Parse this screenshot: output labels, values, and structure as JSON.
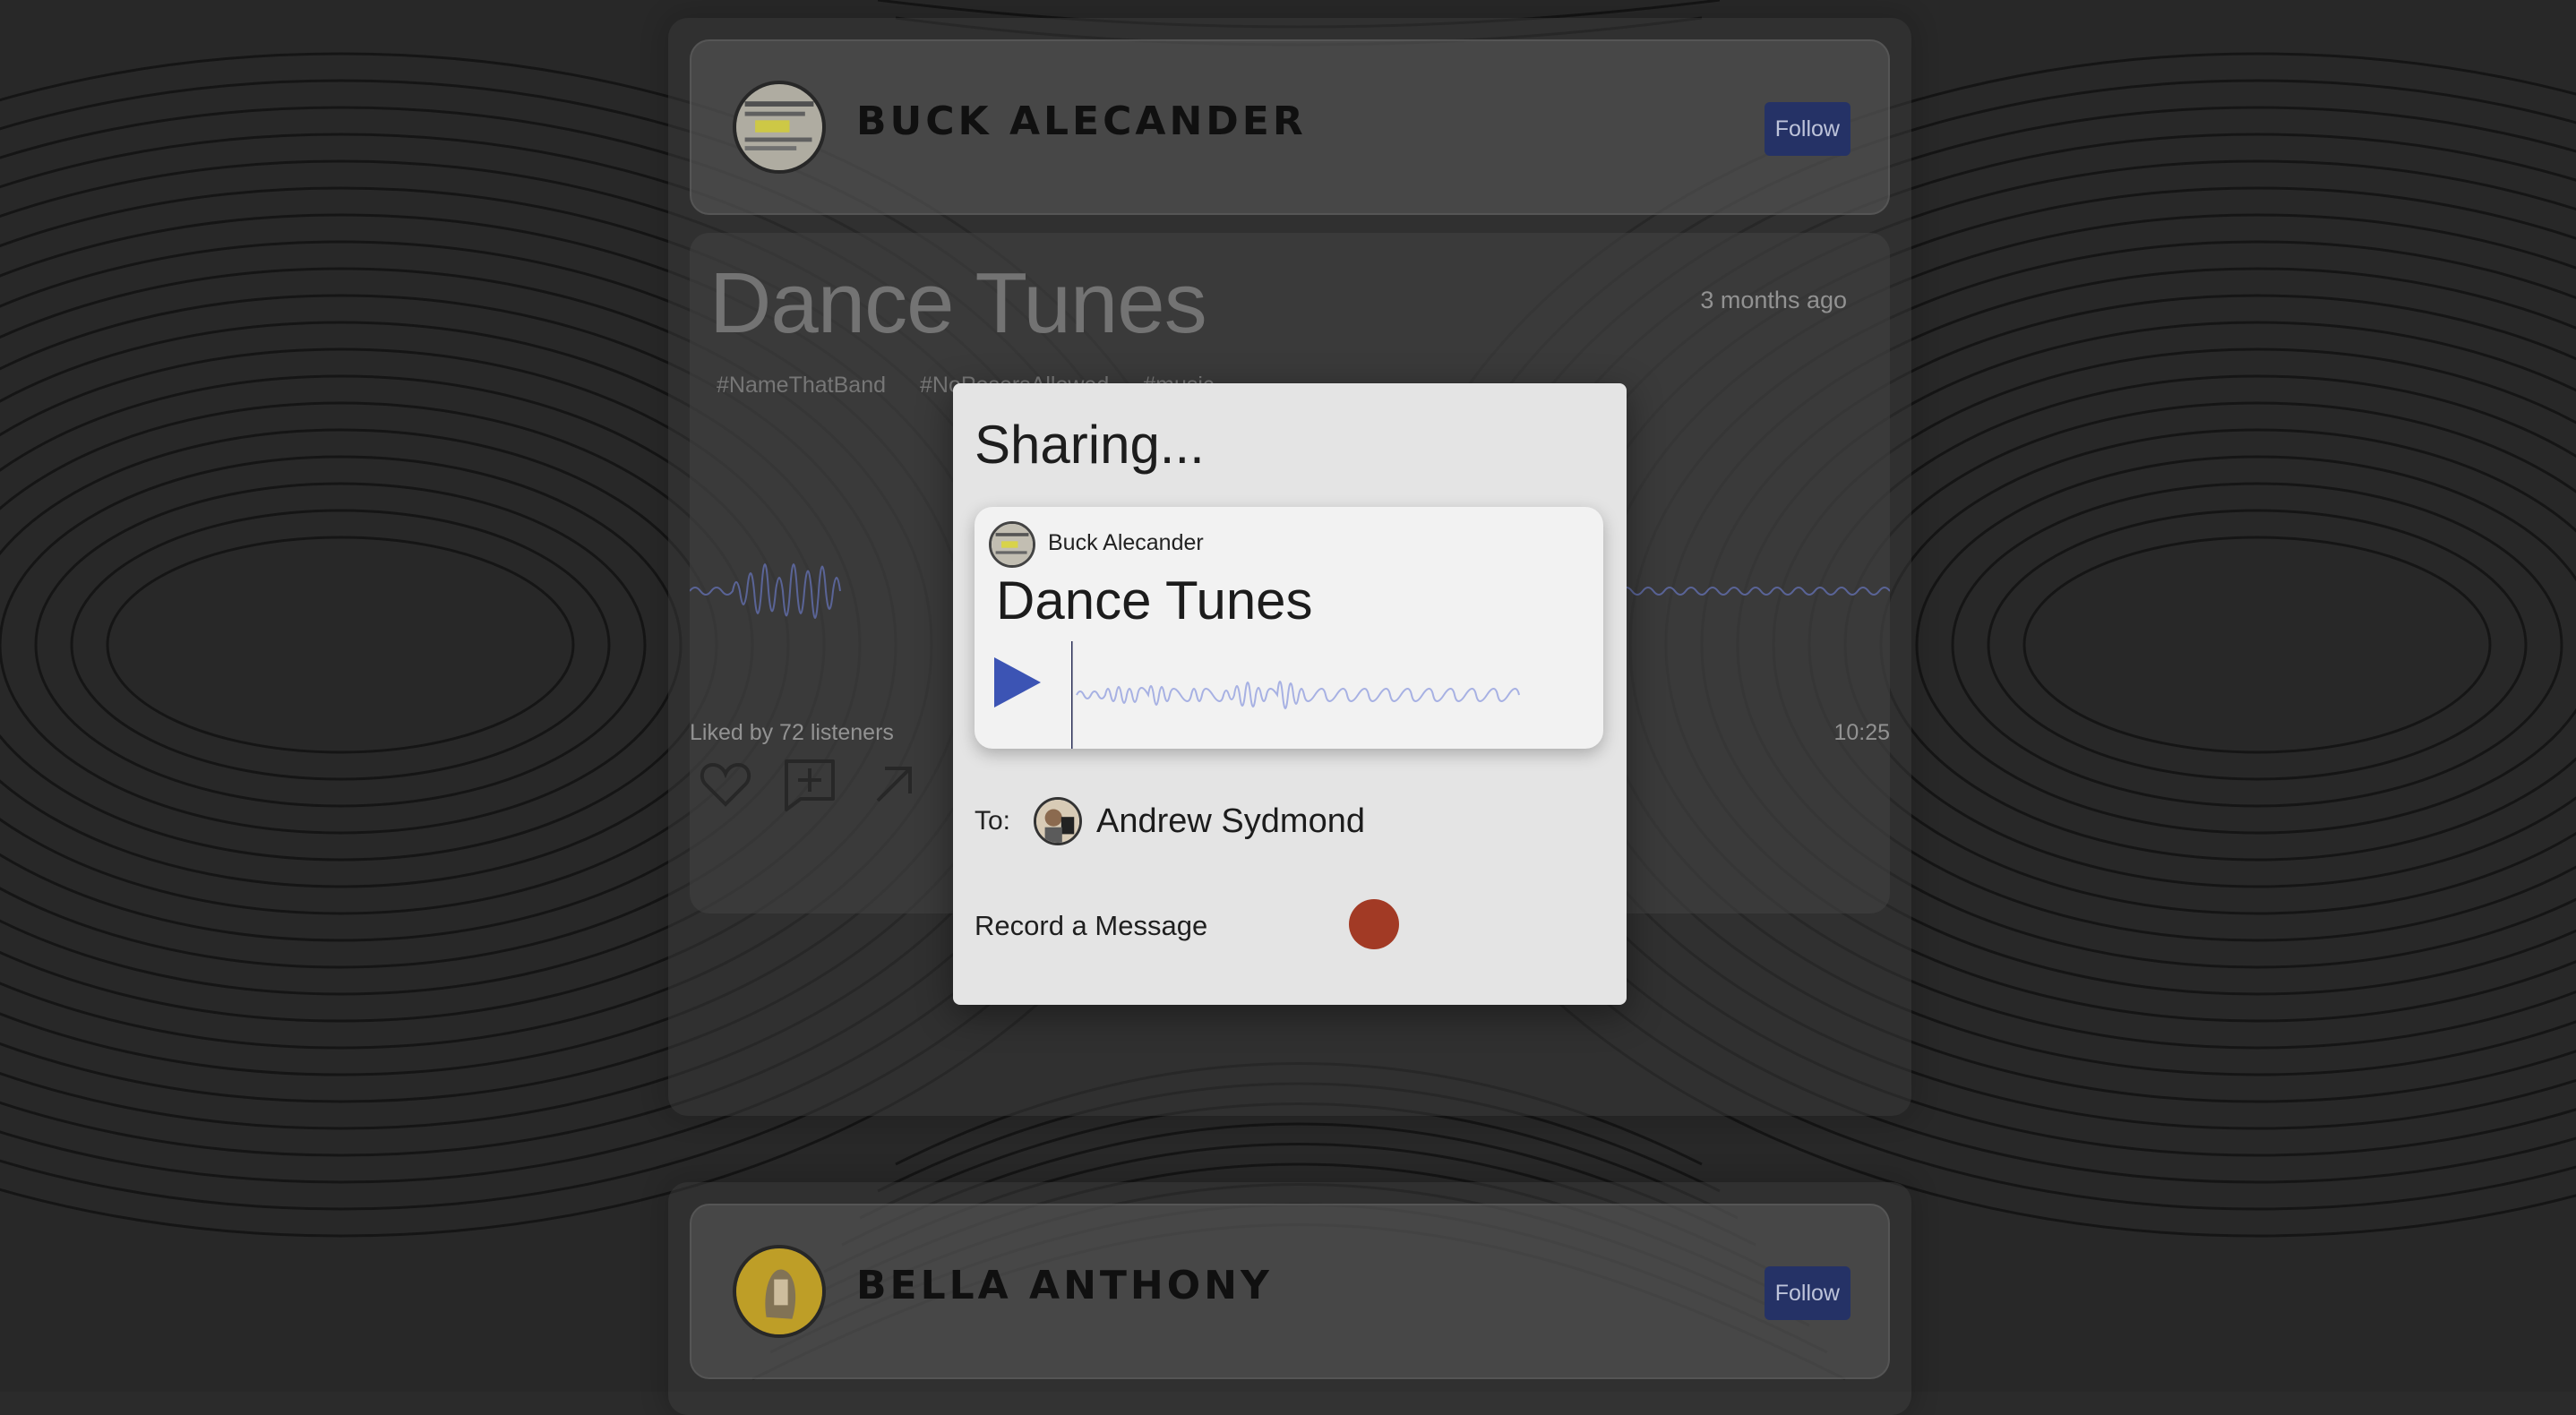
{
  "colors": {
    "accent_play": "#3c54b4",
    "follow_bg": "#27356c",
    "record": "#a23a25"
  },
  "feed": {
    "post1": {
      "artist_name": "Buck Alecander",
      "follow_label": "Follow",
      "track": {
        "title": "Dance Tunes",
        "posted": "3 months ago",
        "tags": [
          "#NameThatBand",
          "#NoPosersAllowed",
          "#music"
        ],
        "likes_text": "Liked by 72 listeners",
        "duration": "10:25"
      },
      "actions": {
        "like_icon": "heart-icon",
        "comment_icon": "add-comment-icon",
        "share_icon": "share-arrow-icon"
      }
    },
    "post2": {
      "artist_name": "Bella Anthony",
      "follow_label": "Follow"
    }
  },
  "share_modal": {
    "title": "Sharing...",
    "card": {
      "artist": "Buck Alecander",
      "track_title": "Dance Tunes",
      "play_icon": "play-icon"
    },
    "to_label": "To:",
    "recipient": "Andrew Sydmond",
    "record_label": "Record a Message",
    "record_icon": "record-button"
  }
}
